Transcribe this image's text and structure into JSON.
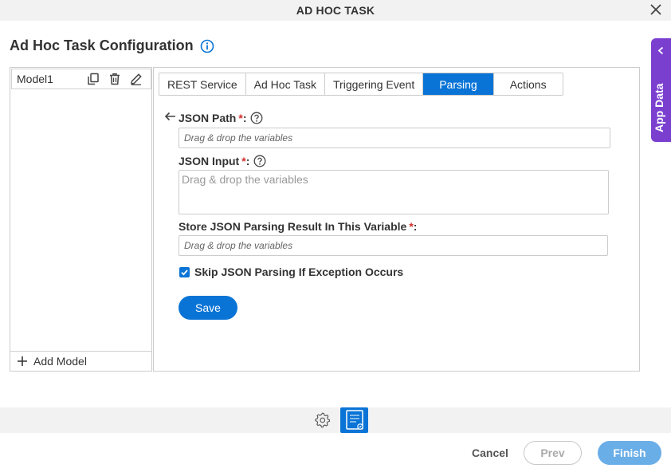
{
  "window": {
    "title": "AD HOC TASK"
  },
  "page": {
    "title": "Ad Hoc Task Configuration"
  },
  "side_panel": {
    "label": "App Data"
  },
  "models": {
    "items": [
      {
        "name": "Model1"
      }
    ],
    "add_label": "Add Model"
  },
  "tabs": [
    {
      "label": "REST Service",
      "active": false
    },
    {
      "label": "Ad Hoc Task",
      "active": false
    },
    {
      "label": "Triggering Event",
      "active": false
    },
    {
      "label": "Parsing",
      "active": true
    },
    {
      "label": "Actions",
      "active": false
    }
  ],
  "form": {
    "json_path": {
      "label": "JSON Path",
      "required_mark": "*",
      "suffix": ":",
      "placeholder": "Drag & drop the variables"
    },
    "json_input": {
      "label": "JSON Input",
      "required_mark": "*",
      "suffix": ":",
      "placeholder": "Drag & drop the variables"
    },
    "store_result": {
      "label": "Store JSON Parsing Result In This Variable",
      "required_mark": "*",
      "suffix": ":",
      "placeholder": "Drag & drop the variables"
    },
    "skip_exception": {
      "label": "Skip JSON Parsing If Exception Occurs",
      "checked": true
    },
    "save_label": "Save"
  },
  "footer": {
    "cancel_label": "Cancel",
    "prev_label": "Prev",
    "finish_label": "Finish"
  },
  "colors": {
    "accent": "#0a74d6",
    "app_data": "#7b3fd0",
    "required": "#d32f2f"
  }
}
